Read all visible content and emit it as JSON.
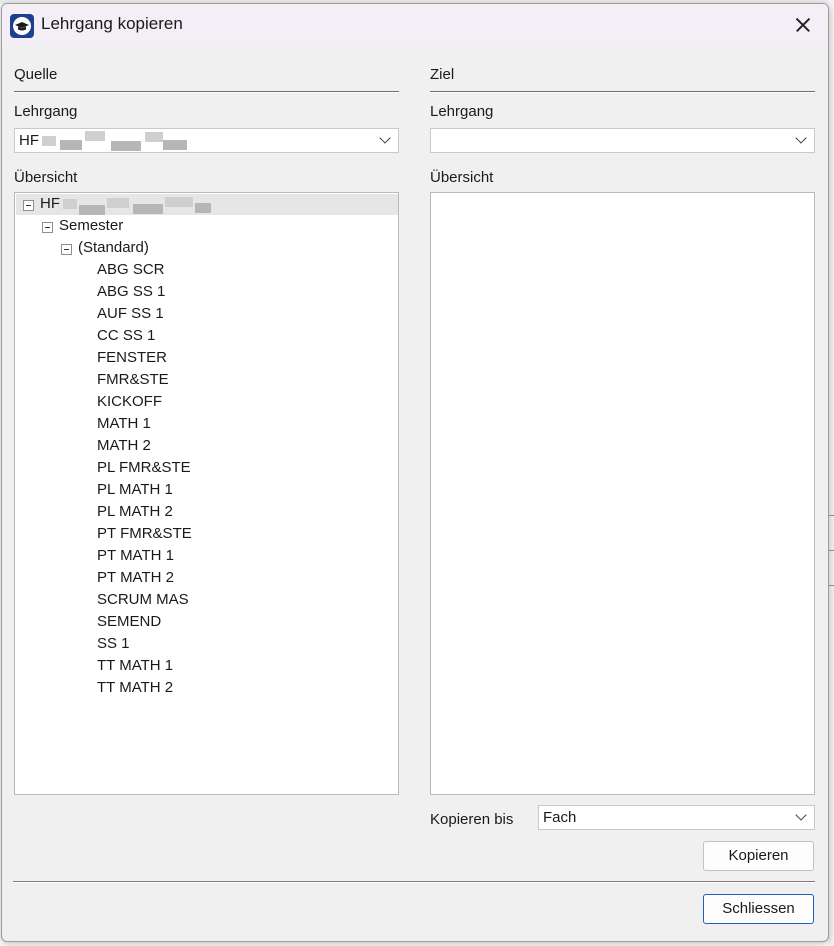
{
  "window": {
    "title": "Lehrgang kopieren"
  },
  "source": {
    "section_label": "Quelle",
    "course_label": "Lehrgang",
    "course_value": "HF",
    "overview_label": "Übersicht",
    "tree": {
      "root": "HF",
      "level1": "Semester",
      "level2": "(Standard)",
      "items": [
        "ABG SCR",
        "ABG SS 1",
        "AUF SS 1",
        "CC SS 1",
        "FENSTER",
        "FMR&STE",
        "KICKOFF",
        "MATH 1",
        "MATH 2",
        "PL FMR&STE",
        "PL MATH 1",
        "PL MATH 2",
        "PT FMR&STE",
        "PT MATH 1",
        "PT MATH 2",
        "SCRUM MAS",
        "SEMEND",
        "SS 1",
        "TT MATH 1",
        "TT MATH 2"
      ]
    }
  },
  "target": {
    "section_label": "Ziel",
    "course_label": "Lehrgang",
    "course_value": "",
    "overview_label": "Übersicht"
  },
  "copy_until": {
    "label": "Kopieren bis",
    "value": "Fach"
  },
  "buttons": {
    "copy": "Kopieren",
    "close": "Schliessen"
  }
}
